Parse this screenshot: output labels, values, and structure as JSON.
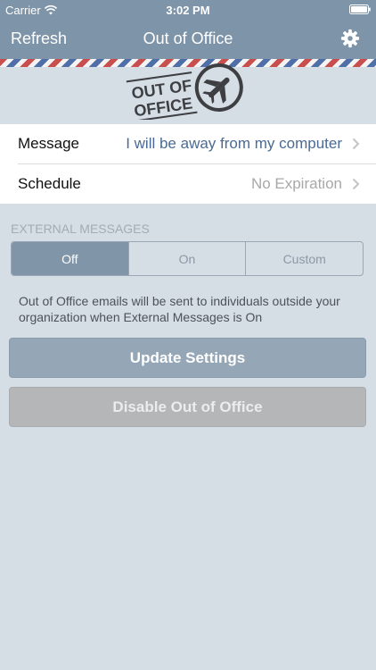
{
  "status_bar": {
    "carrier": "Carrier",
    "time": "3:02 PM",
    "wifi_icon": "wifi-icon",
    "battery_icon": "battery-icon"
  },
  "nav": {
    "left_button": "Refresh",
    "title": "Out of Office",
    "right_icon": "gear-icon"
  },
  "logo": {
    "line1": "OUT OF",
    "line2": "OFFICE",
    "icon": "airplane-icon"
  },
  "settings": {
    "message": {
      "label": "Message",
      "value": "I will be away from my computer"
    },
    "schedule": {
      "label": "Schedule",
      "value": "No Expiration"
    }
  },
  "external": {
    "header": "EXTERNAL MESSAGES",
    "options": [
      "Off",
      "On",
      "Custom"
    ],
    "selected": "Off",
    "info": "Out of Office emails will be sent to individuals outside your organization when External Messages is On"
  },
  "buttons": {
    "update": "Update Settings",
    "disable": "Disable Out of Office"
  },
  "colors": {
    "nav_bar": "#7e94a9",
    "background": "#d5dde5",
    "accent_value": "#4a6a94",
    "stripe_red": "#c94f4f",
    "stripe_blue": "#4f6fa8"
  }
}
